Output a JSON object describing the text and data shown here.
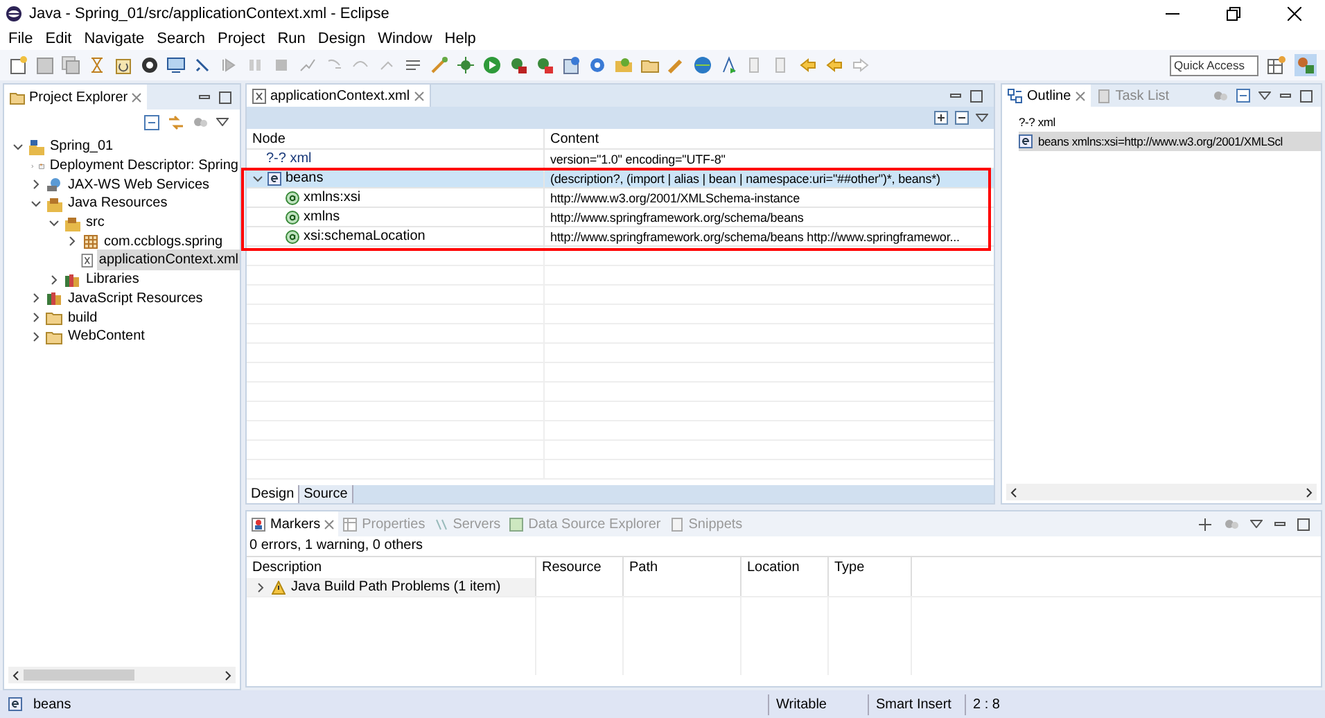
{
  "window": {
    "title": "Java - Spring_01/src/applicationContext.xml - Eclipse"
  },
  "menu": [
    "File",
    "Edit",
    "Navigate",
    "Search",
    "Project",
    "Run",
    "Design",
    "Window",
    "Help"
  ],
  "quick_access": {
    "placeholder": "Quick Access"
  },
  "project_explorer": {
    "title": "Project Explorer",
    "tree": [
      {
        "label": "Spring_01",
        "kind": "project",
        "expanded": true,
        "selected": false,
        "children": [
          {
            "label": "Deployment Descriptor: Spring",
            "kind": "descriptor",
            "expanded": false,
            "selected": false
          },
          {
            "label": "JAX-WS Web Services",
            "kind": "services",
            "expanded": false,
            "selected": false
          },
          {
            "label": "Java Resources",
            "kind": "resources",
            "expanded": true,
            "selected": false,
            "children": [
              {
                "label": "src",
                "kind": "source",
                "expanded": true,
                "selected": false,
                "children": [
                  {
                    "label": "com.ccblogs.spring",
                    "kind": "package",
                    "expanded": false,
                    "selected": false
                  },
                  {
                    "label": "applicationContext.xml",
                    "kind": "xml",
                    "selected": true
                  }
                ]
              },
              {
                "label": "Libraries",
                "kind": "library",
                "expanded": false,
                "selected": false
              }
            ]
          },
          {
            "label": "JavaScript Resources",
            "kind": "library",
            "expanded": false,
            "selected": false
          },
          {
            "label": "build",
            "kind": "folder",
            "expanded": false,
            "selected": false
          },
          {
            "label": "WebContent",
            "kind": "folder",
            "expanded": false,
            "selected": false
          }
        ]
      }
    ]
  },
  "editor": {
    "tab": "applicationContext.xml",
    "columns": [
      "Node",
      "Content"
    ],
    "rows": [
      {
        "kind": "instruction",
        "node": "?-? xml",
        "content": "version=\"1.0\" encoding=\"UTF-8\"",
        "selected": false
      },
      {
        "kind": "element",
        "node": "beans",
        "content": "(description?, (import | alias | bean | namespace:uri=\"##other\")*, beans*)",
        "expanded": true,
        "selected": true
      },
      {
        "kind": "attribute",
        "node": "xmlns:xsi",
        "content": "http://www.w3.org/2001/XMLSchema-instance",
        "selected": false
      },
      {
        "kind": "attribute",
        "node": "xmlns",
        "content": "http://www.springframework.org/schema/beans",
        "selected": false
      },
      {
        "kind": "attribute",
        "node": "xsi:schemaLocation",
        "content": "http://www.springframework.org/schema/beans http://www.springframewor...",
        "selected": false
      }
    ],
    "bottom_tabs": [
      {
        "label": "Design",
        "selected": true
      },
      {
        "label": "Source",
        "selected": false
      }
    ]
  },
  "outline": {
    "tabs": [
      {
        "label": "Outline",
        "selected": true
      },
      {
        "label": "Task List",
        "selected": false
      }
    ],
    "items": [
      {
        "kind": "instruction",
        "label": "?-? xml",
        "selected": false
      },
      {
        "kind": "element",
        "label": "beans xmlns:xsi=http://www.w3.org/2001/XMLScl",
        "selected": true
      }
    ]
  },
  "markers": {
    "tabs": [
      {
        "label": "Markers",
        "selected": true
      },
      {
        "label": "Properties",
        "selected": false
      },
      {
        "label": "Servers",
        "selected": false
      },
      {
        "label": "Data Source Explorer",
        "selected": false
      },
      {
        "label": "Snippets",
        "selected": false
      }
    ],
    "summary": "0 errors, 1 warning, 0 others",
    "columns": [
      "Description",
      "Resource",
      "Path",
      "Location",
      "Type"
    ],
    "rows": [
      {
        "description": "Java Build Path Problems (1 item)",
        "expanded": false
      }
    ]
  },
  "status_bar": {
    "selection": "beans",
    "mode": "Writable",
    "insert": "Smart Insert",
    "position": "2 : 8"
  }
}
